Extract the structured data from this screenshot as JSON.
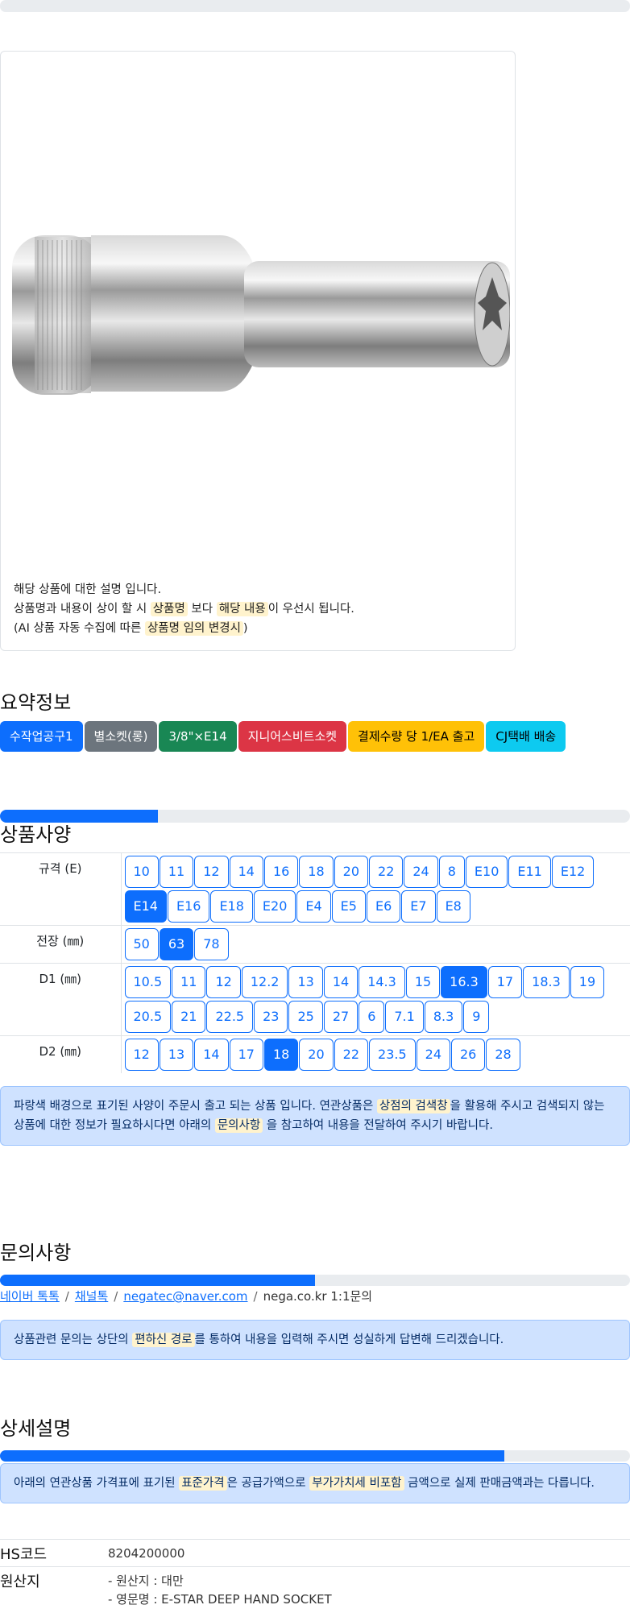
{
  "description": {
    "line1": "해당 상품에 대한 설명 입니다.",
    "line2_pre": "상품명과 내용이 상이 할 시 ",
    "line2_hl1": "상품명",
    "line2_mid": " 보다 ",
    "line2_hl2": "해당 내용",
    "line2_post": "이 우선시 됩니다.",
    "line3_pre": "(AI 상품 자동 수집에 따른 ",
    "line3_hl": "상품명 임의 변경시",
    "line3_post": ")"
  },
  "summary": {
    "title": "요약정보",
    "badges": [
      {
        "label": "수작업공구1",
        "color": "#0d6efd"
      },
      {
        "label": "별소켓(롱)",
        "color": "#6c757d"
      },
      {
        "label": "3/8\"×E14",
        "color": "#198754"
      },
      {
        "label": "지니어스비트소켓",
        "color": "#dc3545"
      },
      {
        "label": "결제수량 당 1/EA 출고",
        "color": "#ffc107"
      },
      {
        "label": "CJ택배 배송",
        "color": "#0dcaf0"
      }
    ]
  },
  "spec": {
    "title": "상품사양",
    "progress": 0.25,
    "rows": [
      {
        "label": "규격 (E)",
        "options": [
          "10",
          "11",
          "12",
          "14",
          "16",
          "18",
          "20",
          "22",
          "24",
          "8",
          "E10",
          "E11",
          "E12",
          "E14",
          "E16",
          "E18",
          "E20",
          "E4",
          "E5",
          "E6",
          "E7",
          "E8"
        ],
        "selected": "E14"
      },
      {
        "label": "전장 (㎜)",
        "options": [
          "50",
          "63",
          "78"
        ],
        "selected": "63"
      },
      {
        "label": "D1 (㎜)",
        "options": [
          "10.5",
          "11",
          "12",
          "12.2",
          "13",
          "14",
          "14.3",
          "15",
          "16.3",
          "17",
          "18.3",
          "19",
          "20.5",
          "21",
          "22.5",
          "23",
          "25",
          "27",
          "6",
          "7.1",
          "8.3",
          "9"
        ],
        "selected": "16.3"
      },
      {
        "label": "D2 (㎜)",
        "options": [
          "12",
          "13",
          "14",
          "17",
          "18",
          "20",
          "22",
          "23.5",
          "24",
          "26",
          "28"
        ],
        "selected": "18"
      }
    ],
    "notice_pre": "파랑색 배경으로 표기된 사양이 주문시 출고 되는 상품 입니다. 연관상품은 ",
    "notice_hl1": "상점의 검색창",
    "notice_mid": "을 활용해 주시고 검색되지 않는 상품에 대한 정보가 필요하시다면 아래의 ",
    "notice_hl2": "문의사항",
    "notice_post": " 을 참고하여 내용을 전달하여 주시기 바랍니다."
  },
  "inquiry": {
    "title": "문의사항",
    "progress": 0.5,
    "links": [
      "네이버 톡톡",
      "채널톡",
      "negatec@naver.com"
    ],
    "plain": "nega.co.kr 1:1문의",
    "notice_pre": "상품관련 문의는 상단의 ",
    "notice_hl": "편하신 경로",
    "notice_post": "를 통하여 내용을 입력해 주시면 성실하게 답변해 드리겠습니다."
  },
  "detail": {
    "title": "상세설명",
    "progress": 0.8,
    "notice_pre": "아래의 연관상품 가격표에 표기된 ",
    "notice_hl1": "표준가격",
    "notice_mid": "은 공급가액으로 ",
    "notice_hl2": "부가가치세 비포함",
    "notice_post": " 금액으로 실제 판매금액과는 다릅니다.",
    "hs_label": "HS코드",
    "hs_value": "8204200000",
    "origin_label": "원산지",
    "origin_line1": "- 원산지 : 대만",
    "origin_line2": "- 영문명 : E-STAR DEEP HAND SOCKET"
  }
}
